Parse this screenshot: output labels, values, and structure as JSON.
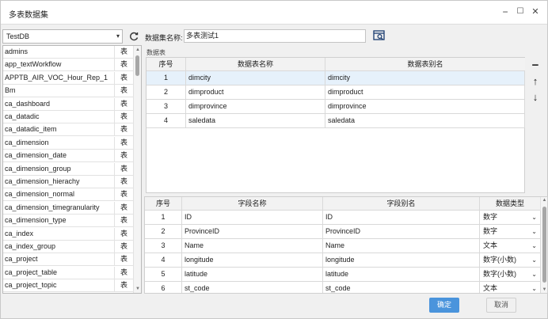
{
  "window": {
    "title": "多表数据集",
    "minimize": "−",
    "maximize": "☐",
    "close": "✕"
  },
  "left": {
    "db_select": "TestDB",
    "tables": [
      {
        "name": "admins",
        "type": "表"
      },
      {
        "name": "app_textWorkflow",
        "type": "表"
      },
      {
        "name": "APPTB_AIR_VOC_Hour_Rep_1",
        "type": "表"
      },
      {
        "name": "Bm",
        "type": "表"
      },
      {
        "name": "ca_dashboard",
        "type": "表"
      },
      {
        "name": "ca_datadic",
        "type": "表"
      },
      {
        "name": "ca_datadic_item",
        "type": "表"
      },
      {
        "name": "ca_dimension",
        "type": "表"
      },
      {
        "name": "ca_dimension_date",
        "type": "表"
      },
      {
        "name": "ca_dimension_group",
        "type": "表"
      },
      {
        "name": "ca_dimension_hierachy",
        "type": "表"
      },
      {
        "name": "ca_dimension_normal",
        "type": "表"
      },
      {
        "name": "ca_dimension_timegranularity",
        "type": "表"
      },
      {
        "name": "ca_dimension_type",
        "type": "表"
      },
      {
        "name": "ca_index",
        "type": "表"
      },
      {
        "name": "ca_index_group",
        "type": "表"
      },
      {
        "name": "ca_project",
        "type": "表"
      },
      {
        "name": "ca_project_table",
        "type": "表"
      },
      {
        "name": "ca_project_topic",
        "type": "表"
      }
    ]
  },
  "dataset": {
    "name_label": "数据集名称:",
    "name_value": "多表测试1",
    "section_label": "数据表"
  },
  "data_tables": {
    "headers": [
      "序号",
      "数据表名称",
      "数据表别名"
    ],
    "rows": [
      {
        "no": "1",
        "name": "dimcity",
        "alias": "dimcity"
      },
      {
        "no": "2",
        "name": "dimproduct",
        "alias": "dimproduct"
      },
      {
        "no": "3",
        "name": "dimprovince",
        "alias": "dimprovince"
      },
      {
        "no": "4",
        "name": "saledata",
        "alias": "saledata"
      }
    ]
  },
  "side_buttons": {
    "remove": "−",
    "up": "↑",
    "down": "↓"
  },
  "fields": {
    "headers": [
      "序号",
      "字段名称",
      "字段别名",
      "数据类型"
    ],
    "rows": [
      {
        "no": "1",
        "name": "ID",
        "alias": "ID",
        "type": "数字"
      },
      {
        "no": "2",
        "name": "ProvinceID",
        "alias": "ProvinceID",
        "type": "数字"
      },
      {
        "no": "3",
        "name": "Name",
        "alias": "Name",
        "type": "文本"
      },
      {
        "no": "4",
        "name": "longitude",
        "alias": "longitude",
        "type": "数字(小数)"
      },
      {
        "no": "5",
        "name": "latitude",
        "alias": "latitude",
        "type": "数字(小数)"
      },
      {
        "no": "6",
        "name": "st_code",
        "alias": "st_code",
        "type": "文本"
      }
    ]
  },
  "footer": {
    "ok": "确定",
    "cancel": "取消"
  },
  "colors": {
    "accent": "#4a94dc",
    "selected_row": "#e6f1fb"
  },
  "icons": [
    "refresh-icon",
    "search-icon",
    "chevron-down-icon",
    "minimize-icon",
    "maximize-icon",
    "close-icon"
  ]
}
